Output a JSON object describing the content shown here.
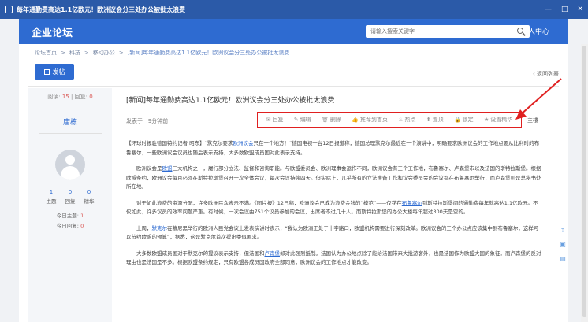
{
  "window": {
    "title": "每年通勤费高达1.1亿欧元！欧洲议会分三处办公被批太浪费",
    "controls": [
      "—",
      "□",
      "✕"
    ]
  },
  "navbar": {
    "logo": "企业论坛",
    "search_placeholder": "请输入搜索关键字",
    "user_center": "个人中心"
  },
  "breadcrumb": {
    "items": [
      "论坛首页",
      "科技",
      "移动办公"
    ],
    "separator": ">",
    "current": "[新闻]每年通勤费高达1.1亿欧元！欧洲议会分三处办公被批太浪费"
  },
  "toolbar": {
    "post_label": "发帖",
    "back_label": "返回列表"
  },
  "sidebar": {
    "views_label": "阅读:",
    "views": "15",
    "replies_label": "回复:",
    "replies": "0",
    "username": "唐栋",
    "counts": [
      {
        "value": "1",
        "label": "主题"
      },
      {
        "value": "0",
        "label": "回复"
      },
      {
        "value": "0",
        "label": "精华"
      }
    ],
    "today_posts_label": "今日主题:",
    "today_posts": "1",
    "today_replies_label": "今日回复:",
    "today_replies": "0"
  },
  "post": {
    "title": "[新闻]每年通勤费高达1.1亿欧元！欧洲议会分三处办公被批太浪费",
    "meta_prefix": "发表于",
    "meta_time": "9分钟前",
    "floor_label": "主楼",
    "actions": [
      {
        "icon": "reply-icon",
        "glyph": "✉",
        "label": "回复"
      },
      {
        "icon": "edit-icon",
        "glyph": "✎",
        "label": "编辑"
      },
      {
        "icon": "delete-icon",
        "glyph": "🗑",
        "label": "删除"
      },
      {
        "icon": "recommend-icon",
        "glyph": "👍",
        "label": "推荐到首页"
      },
      {
        "icon": "hot-icon",
        "glyph": "♨",
        "label": "热点"
      },
      {
        "icon": "top-icon",
        "glyph": "⬆",
        "label": "置顶"
      },
      {
        "icon": "lock-icon",
        "glyph": "🔒",
        "label": "锁定"
      },
      {
        "icon": "essence-icon",
        "glyph": "★",
        "label": "设置精华"
      }
    ],
    "paragraphs": [
      {
        "pre": "【环球时报驻德国特约记者 昭东】“默克尔要求",
        "link": "欧洲议会",
        "post": "只在一个地方！”德国电视一台12日报道称，德国总理默克尔最近在一个演讲中，明确要求欧洲议会的工作地点要从比利时的布鲁塞尔，一些欧洲议会议员也随后表示支持，大多数欧盟成员国对此表示支持。"
      },
      {
        "pre": "欧洲议会是",
        "link": "欧盟",
        "post": "三大机构之一，履行部分立法、监督和咨询职能。与欧盟委员会、欧洲理事会运作不同，欧洲议会有三个工作地，布鲁塞尔、卢森堡市以及法国的斯特拉斯堡。根据欧盟条约，欧洲议会每月必须在斯特拉斯堡召开一次全体会议，每次会议持续四天。但实际上，几乎所有的立法准备工作和议会委员会的会议都在布鲁塞尔举行，而卢森堡则是总秘书处所在地。"
      },
      {
        "pre": "对于如此浪费的资源分配，许多欧洲民众表示不满。《图片报》12日称，欧洲议会已成为浪费金钱的“模范”——仅花在",
        "link": "布鲁塞尔",
        "post": "到斯特拉斯堡间的通勤费每年就高达1.1亿欧元。不仅如此，许多议员的效率问题严重。有时候，一次会议由751个议员参加的会议，出席者不过几十人。而斯特拉斯堡的办公大楼每年超过300天是空的。"
      },
      {
        "pre": "上周，",
        "link": "默克尔",
        "post": "在慕尼黑举行的欧洲人民党会议上发表演讲时表示，“我认为欧洲正处于十字路口，欧盟机构需要进行深刻改革。欧洲议会的三个办公点应该集中到布鲁塞尔，这样可以节约欧盟的预算”，据悉，这是默克尔首次提出类似要求。"
      },
      {
        "pre": "大多数欧盟成员国对于默克尔的提议表示支持，但法国和",
        "link": "卢森堡",
        "post": "却对此强烈抵制。法国认为办公地点除了能给法国带来大批游客外，也是法国作为欧盟大国的象征。而卢森堡的反对理由也是法国是不多。根据欧盟条约规定，只有欧盟各成员国政府全部同意，欧洲议会的工作地点才能改变。"
      }
    ]
  },
  "side_tools": [
    "back-to-top-icon",
    "folder-icon",
    "chat-icon"
  ],
  "colors": {
    "titlebar": "#2b5aa8",
    "navbar": "#2e6bd1",
    "highlight_box": "#e02020",
    "count_red": "#d9534f"
  }
}
